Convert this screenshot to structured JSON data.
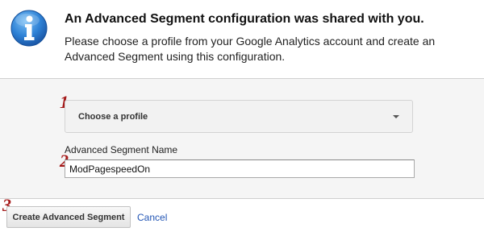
{
  "header": {
    "icon": "info-icon",
    "title": "An Advanced Segment configuration was shared with you.",
    "description": "Please choose a profile from your Google Analytics account and create an Advanced Segment using this configuration."
  },
  "steps": {
    "one": "1",
    "two": "2",
    "three": "3"
  },
  "form": {
    "profile_select_value": "Choose a profile",
    "segment_name_label": "Advanced Segment Name",
    "segment_name_value": "ModPagespeedOn"
  },
  "actions": {
    "create_label": "Create Advanced Segment",
    "cancel_label": "Cancel"
  },
  "colors": {
    "step_number": "#a51a1a",
    "link": "#2255b5",
    "info_icon": "#1e6fc4"
  }
}
